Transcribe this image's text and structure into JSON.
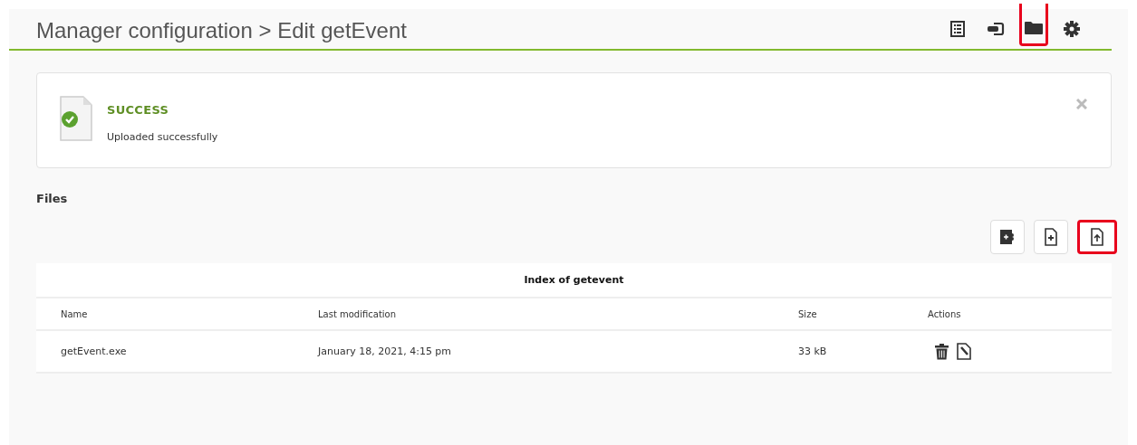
{
  "header": {
    "title": "Manager configuration > Edit getEvent",
    "icons": [
      {
        "kind": "list",
        "highlighted": false
      },
      {
        "kind": "exit",
        "highlighted": false
      },
      {
        "kind": "folder",
        "highlighted": true
      },
      {
        "kind": "gear",
        "highlighted": false
      }
    ]
  },
  "alert": {
    "kind": "success",
    "title": "SUCCESS",
    "message": "Uploaded successfully"
  },
  "files": {
    "heading": "Files",
    "buttons": [
      {
        "kind": "plugin",
        "highlighted": false
      },
      {
        "kind": "new-file",
        "highlighted": false
      },
      {
        "kind": "upload",
        "highlighted": true
      }
    ],
    "table": {
      "caption": "Index of getevent",
      "columns": [
        "Name",
        "Last modification",
        "Size",
        "Actions"
      ],
      "rows": [
        {
          "name": "getEvent.exe",
          "modified": "January 18, 2021, 4:15 pm",
          "size": "33 kB",
          "actions": [
            {
              "kind": "delete"
            },
            {
              "kind": "edit"
            }
          ]
        }
      ]
    }
  }
}
